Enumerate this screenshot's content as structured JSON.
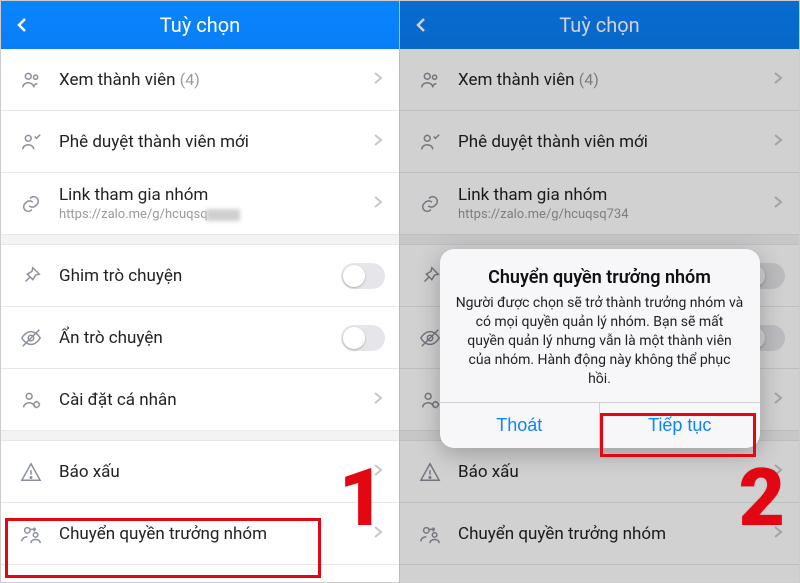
{
  "header": {
    "title": "Tuỳ chọn"
  },
  "rows": {
    "members": {
      "label": "Xem thành viên",
      "count": "(4)"
    },
    "approve": {
      "label": "Phê duyệt thành viên mới"
    },
    "link": {
      "label": "Link tham gia nhóm",
      "sub_left": "https://zalo.me/g/hcuqsq",
      "sub_right": "https://zalo.me/g/hcuqsq734"
    },
    "pin": {
      "label": "Ghim trò chuyện"
    },
    "hide": {
      "label": "Ẩn trò chuyện"
    },
    "personal": {
      "label": "Cài đặt cá nhân"
    },
    "report": {
      "label": "Báo xấu"
    },
    "transfer": {
      "label": "Chuyển quyền trưởng nhóm"
    }
  },
  "dialog": {
    "title": "Chuyển quyền trưởng nhóm",
    "message": "Người được chọn sẽ trở thành trưởng nhóm và có mọi quyền quản lý nhóm. Bạn sẽ mất quyền quản lý nhưng vẫn là một thành viên của nhóm. Hành động này không thể phục hồi.",
    "cancel": "Thoát",
    "confirm": "Tiếp tục"
  },
  "annotations": {
    "step1": "1",
    "step2": "2"
  }
}
